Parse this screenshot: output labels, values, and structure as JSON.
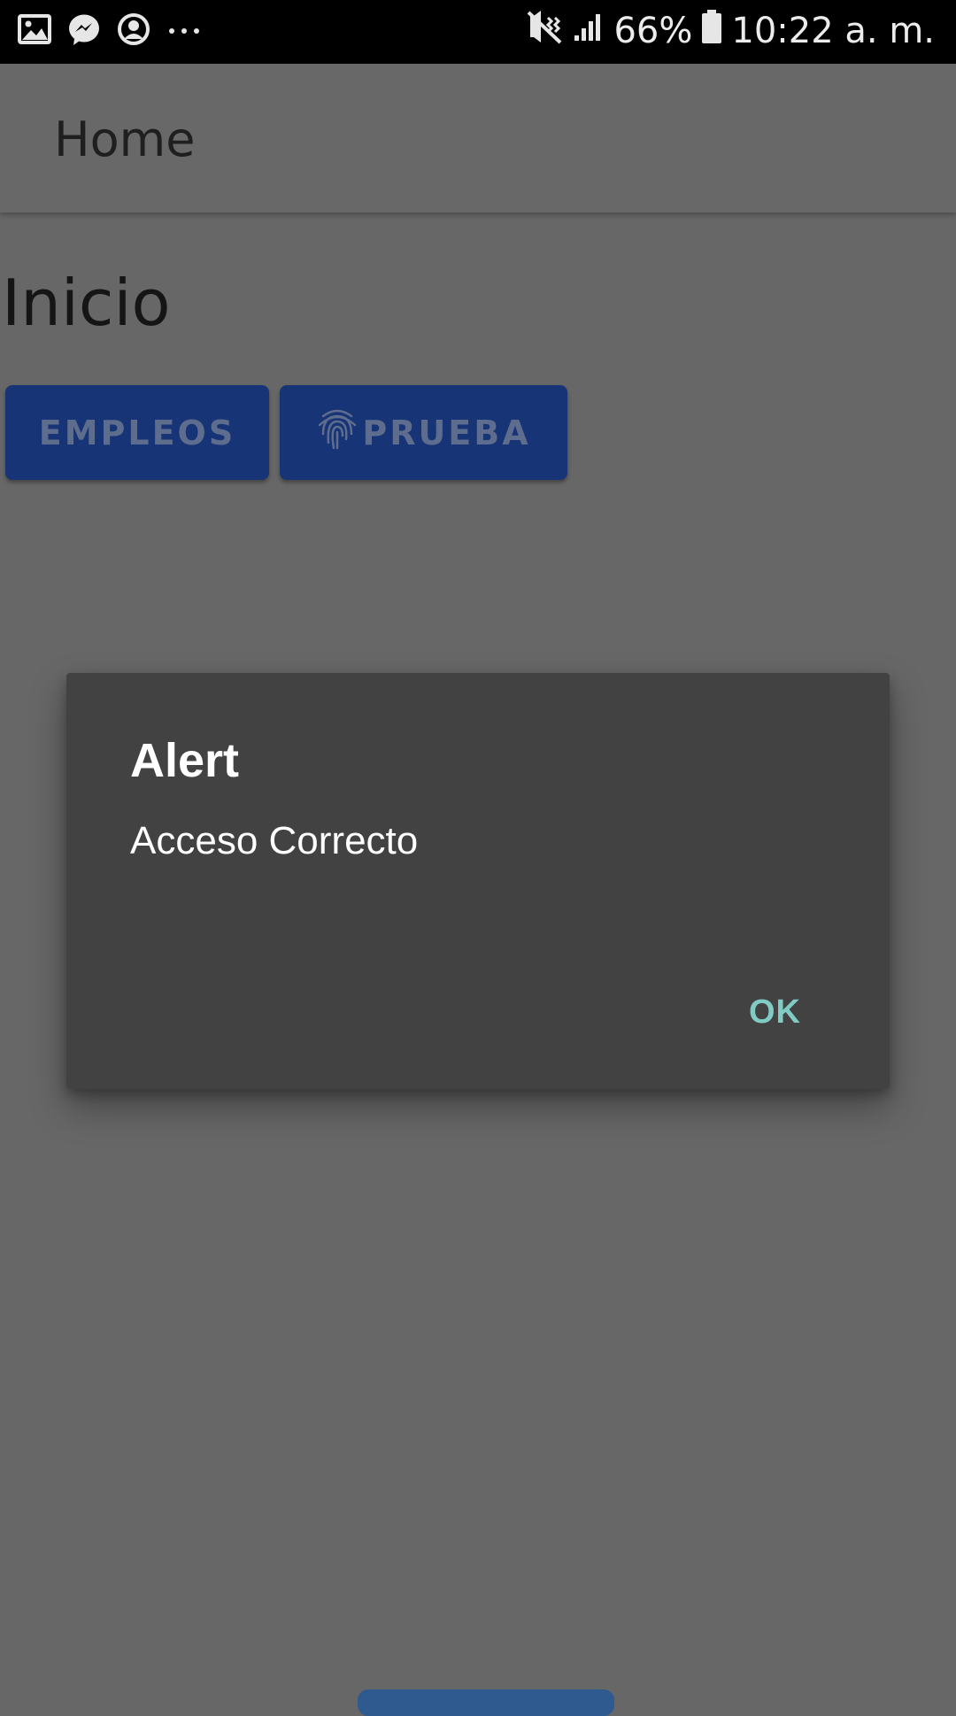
{
  "status_bar": {
    "icons_left": [
      "gallery-icon",
      "messenger-icon",
      "account-icon",
      "more-dots-icon"
    ],
    "icons_right": [
      "vibrate-mute-icon",
      "signal-icon",
      "battery-icon"
    ],
    "battery": "66%",
    "time": "10:22 a. m."
  },
  "app_bar": {
    "title": "Home"
  },
  "page": {
    "heading": "Inicio",
    "buttons": [
      {
        "label": "EMPLEOS"
      },
      {
        "label": "PRUEBA",
        "icon": "fingerprint-icon"
      }
    ]
  },
  "dialog": {
    "title": "Alert",
    "message": "Acceso Correcto",
    "ok_label": "OK"
  },
  "colors": {
    "scrim": "#676767",
    "button_bg": "#173476",
    "dialog_bg": "#424242",
    "accent": "#80cbc4"
  }
}
